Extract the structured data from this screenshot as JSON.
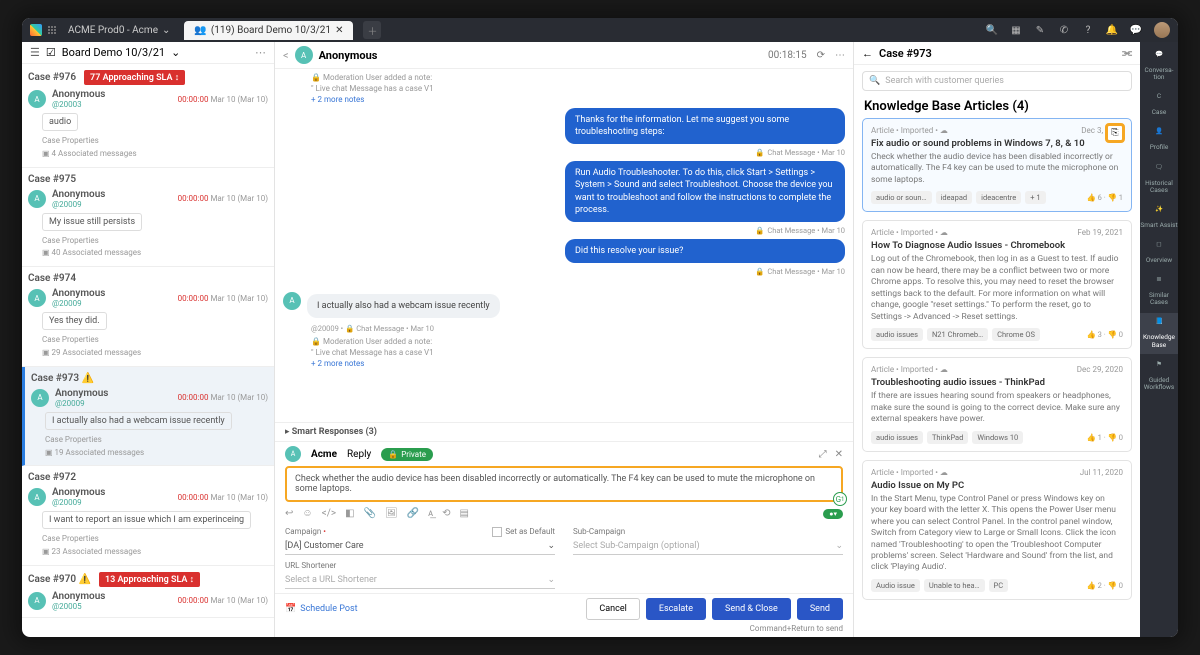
{
  "titlebar": {
    "org": "ACME Prod0 - Acme",
    "tab": "(119) Board Demo 10/3/21"
  },
  "cases_header": "Board Demo 10/3/21",
  "cases": [
    {
      "id": "Case #976",
      "sla": "77 Approaching SLA",
      "name": "Anonymous",
      "handle": "@20003",
      "time_red": "00:00:00",
      "time": "Mar 10 (Mar 10)",
      "msg": "audio",
      "props": "Case Properties",
      "assoc": "4 Associated messages"
    },
    {
      "id": "Case #975",
      "name": "Anonymous",
      "handle": "@20009",
      "time_red": "00:00:00",
      "time": "Mar 10 (Mar 10)",
      "msg": "My issue still persists",
      "props": "Case Properties",
      "assoc": "40 Associated messages"
    },
    {
      "id": "Case #974",
      "name": "Anonymous",
      "handle": "@20009",
      "time_red": "00:00:00",
      "time": "Mar 10 (Mar 10)",
      "msg": "Yes they did.",
      "props": "Case Properties",
      "assoc": "29 Associated messages"
    },
    {
      "id": "Case #973",
      "warn": true,
      "name": "Anonymous",
      "handle": "@20009",
      "time_red": "00:00:00",
      "time": "Mar 10 (Mar 10)",
      "msg": "I actually also had a webcam issue recently",
      "props": "Case Properties",
      "assoc": "19 Associated messages",
      "selected": true
    },
    {
      "id": "Case #972",
      "name": "Anonymous",
      "handle": "@20009",
      "time_red": "00:00:00",
      "time": "Mar 10 (Mar 10)",
      "msg": "I want to report an issue which I am experinceing",
      "props": "Case Properties",
      "assoc": "23 Associated messages"
    },
    {
      "id": "Case #970",
      "warn": true,
      "sla": "13 Approaching SLA",
      "name": "Anonymous",
      "handle": "@20005",
      "time_red": "00:00:00",
      "time": "Mar 10 (Mar 10)"
    }
  ],
  "convo": {
    "title": "Anonymous",
    "timer": "00:18:15",
    "notes": {
      "l1": "Moderation User added a note:",
      "l2": "\" Live chat Message has a case V1",
      "more": "+ 2 more notes"
    },
    "sent": [
      {
        "text": "Thanks for the information. Let me suggest you some troubleshooting steps:",
        "meta": "Chat Message • Mar 10"
      },
      {
        "text": "Run Audio Troubleshooter. To do this, click Start > Settings > System > Sound and select Troubleshoot. Choose the device you want to troubleshoot and follow the instructions to complete the process.",
        "meta": "Chat Message • Mar 10"
      },
      {
        "text": "Did this resolve your issue?",
        "meta": "Chat Message • Mar 10"
      }
    ],
    "incoming": {
      "text": "I actually also had a webcam issue recently",
      "meta": "@20009 • 🔒 Chat Message • Mar 10"
    },
    "notes2": {
      "l1": "Moderation User added a note:",
      "l2": "\" Live chat Message has a case V1",
      "more": "+ 2 more notes"
    },
    "smart": "Smart Responses (3)"
  },
  "composer": {
    "who": "Acme",
    "reply": "Reply",
    "priv": "Private",
    "text": "Check whether the audio device has been disabled incorrectly or automatically. The F4 key can be used to mute the microphone on some laptops.",
    "campaign_label": "Campaign",
    "campaign_value": "[DA] Customer Care",
    "default": "Set as Default",
    "subc_label": "Sub-Campaign",
    "subc_ph": "Select Sub-Campaign (optional)",
    "url_label": "URL Shortener",
    "url_ph": "Select a URL Shortener",
    "schedule": "Schedule Post",
    "cancel": "Cancel",
    "escalate": "Escalate",
    "sendclose": "Send & Close",
    "send": "Send",
    "hint": "Command+Return to send"
  },
  "kb": {
    "header": "Case #973",
    "search_ph": "Search with customer queries",
    "title": "Knowledge Base Articles (4)",
    "cards": [
      {
        "hl": true,
        "meta": "Article • Imported •",
        "date": "Dec 3, 2020",
        "ttl": "Fix audio or sound problems in Windows 7, 8, & 10",
        "desc": "Check whether the audio device has been disabled incorrectly or automatically. The F4 key can be used to mute the microphone on some laptops.",
        "tags": [
          "audio or soun…",
          "ideapad",
          "ideacentre",
          "+ 1"
        ],
        "up": 6,
        "down": 1,
        "insert": true
      },
      {
        "meta": "Article • Imported •",
        "date": "Feb 19, 2021",
        "ttl": "How To Diagnose Audio Issues - Chromebook",
        "desc": "Log out of the Chromebook, then log in as a Guest to test. If audio can now be heard, there may be a conflict between two or more Chrome apps. To resolve this, you may need to reset the browser settings back to the default. For more information on what will change, google \"reset settings.\" To perform the reset, go to Settings -> Advanced -> Reset settings.",
        "tags": [
          "audio issues",
          "N21 Chromeb…",
          "Chrome OS"
        ],
        "up": 3,
        "down": 0
      },
      {
        "meta": "Article • Imported •",
        "date": "Dec 29, 2020",
        "ttl": "Troubleshooting audio issues - ThinkPad",
        "desc": "If there are issues hearing sound from speakers or headphones, make sure the sound is going to the correct device. Make sure any external speakers have power.",
        "tags": [
          "audio issues",
          "ThinkPad",
          "Windows 10"
        ],
        "up": 1,
        "down": 0
      },
      {
        "meta": "Article • Imported •",
        "date": "Jul 11, 2020",
        "ttl": "Audio Issue on My PC",
        "desc": "In the Start Menu, type Control Panel or press Windows key on your key board with the letter X. This opens the Power User menu where you can select Control Panel. In the control panel window, Switch from Category view to Large or Small Icons. Click the icon named 'Troubleshooting' to open the 'Troubleshoot Computer problems' screen. Select 'Hardware and Sound' from the list, and click 'Playing Audio'.",
        "tags": [
          "Audio issue",
          "Unable to hea…",
          "PC"
        ],
        "up": 2,
        "down": 0
      }
    ]
  },
  "rail": [
    {
      "label": "Conversa-tion"
    },
    {
      "label": "Case"
    },
    {
      "label": "Profile"
    },
    {
      "label": "Historical Cases"
    },
    {
      "label": "Smart Assist"
    },
    {
      "label": "Overview"
    },
    {
      "label": "Similar Cases"
    },
    {
      "label": "Knowledge Base",
      "act": true
    },
    {
      "label": "Guided Workflows"
    }
  ]
}
